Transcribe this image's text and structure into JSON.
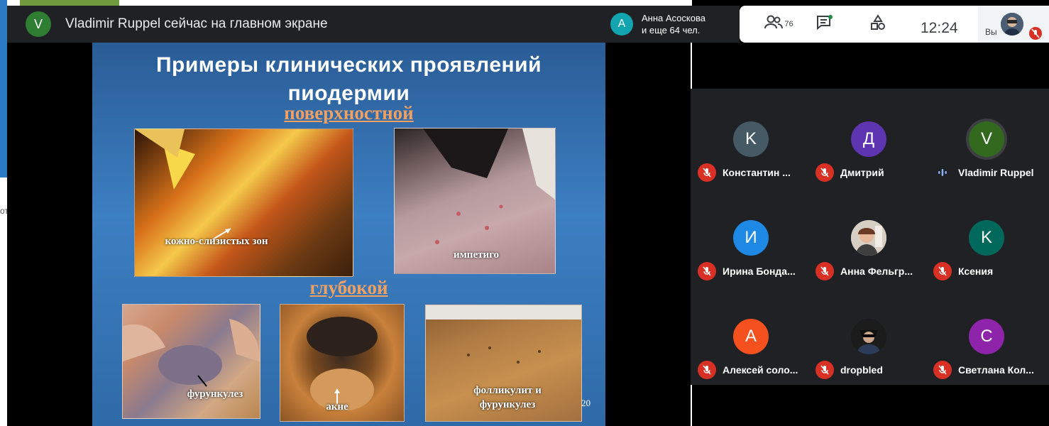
{
  "presenter_banner": {
    "initial": "V",
    "text": "Vladimir Ruppel сейчас на главном экране"
  },
  "audience_pill": {
    "initial": "A",
    "line1": "Анна Асоскова",
    "line2": "и еще 64 чел."
  },
  "toolbar": {
    "people_count": "76",
    "time": "12:24",
    "self_label": "Вы"
  },
  "edge_fragment": "от",
  "slide": {
    "title_line1": "Примеры клинических проявлений",
    "title_line2": "пиодермии",
    "subtitle_surface": "поверхностной",
    "subtitle_deep": "глубокой",
    "captions": {
      "mucocutaneous": "кожно-слизистых зон",
      "impetigo": "импетиго",
      "furunculosis": "фурункулез",
      "acne": "акне",
      "folliculitis_line1": "фолликулит и",
      "folliculitis_line2": "фурункулез"
    },
    "page_number": "20"
  },
  "participants": [
    {
      "initial": "K",
      "name": "Константин ...",
      "color": "#455a64",
      "muted": true
    },
    {
      "initial": "Д",
      "name": "Дмитрий",
      "color": "#5e35b1",
      "muted": true
    },
    {
      "initial": "V",
      "name": "Vladimir Ruppel",
      "color": "#33691e",
      "muted": false,
      "speaking": true
    },
    {
      "initial": "И",
      "name": "Ирина Бонда...",
      "color": "#1e88e5",
      "muted": true
    },
    {
      "initial": "",
      "name": "Анна Фельгр...",
      "color": "#c9b5a5",
      "muted": true,
      "photo": true
    },
    {
      "initial": "K",
      "name": "Ксения",
      "color": "#00695c",
      "muted": true
    },
    {
      "initial": "A",
      "name": "Алексей соло...",
      "color": "#f4511e",
      "muted": true
    },
    {
      "initial": "",
      "name": "dropbled",
      "color": "#2a2a2a",
      "muted": true,
      "photo": true
    },
    {
      "initial": "C",
      "name": "Светлана Кол...",
      "color": "#8e24aa",
      "muted": true
    }
  ],
  "colors": {
    "mic_off": "#d93025",
    "speaking": "#8ab4f8",
    "banner_bg": "#202124"
  }
}
